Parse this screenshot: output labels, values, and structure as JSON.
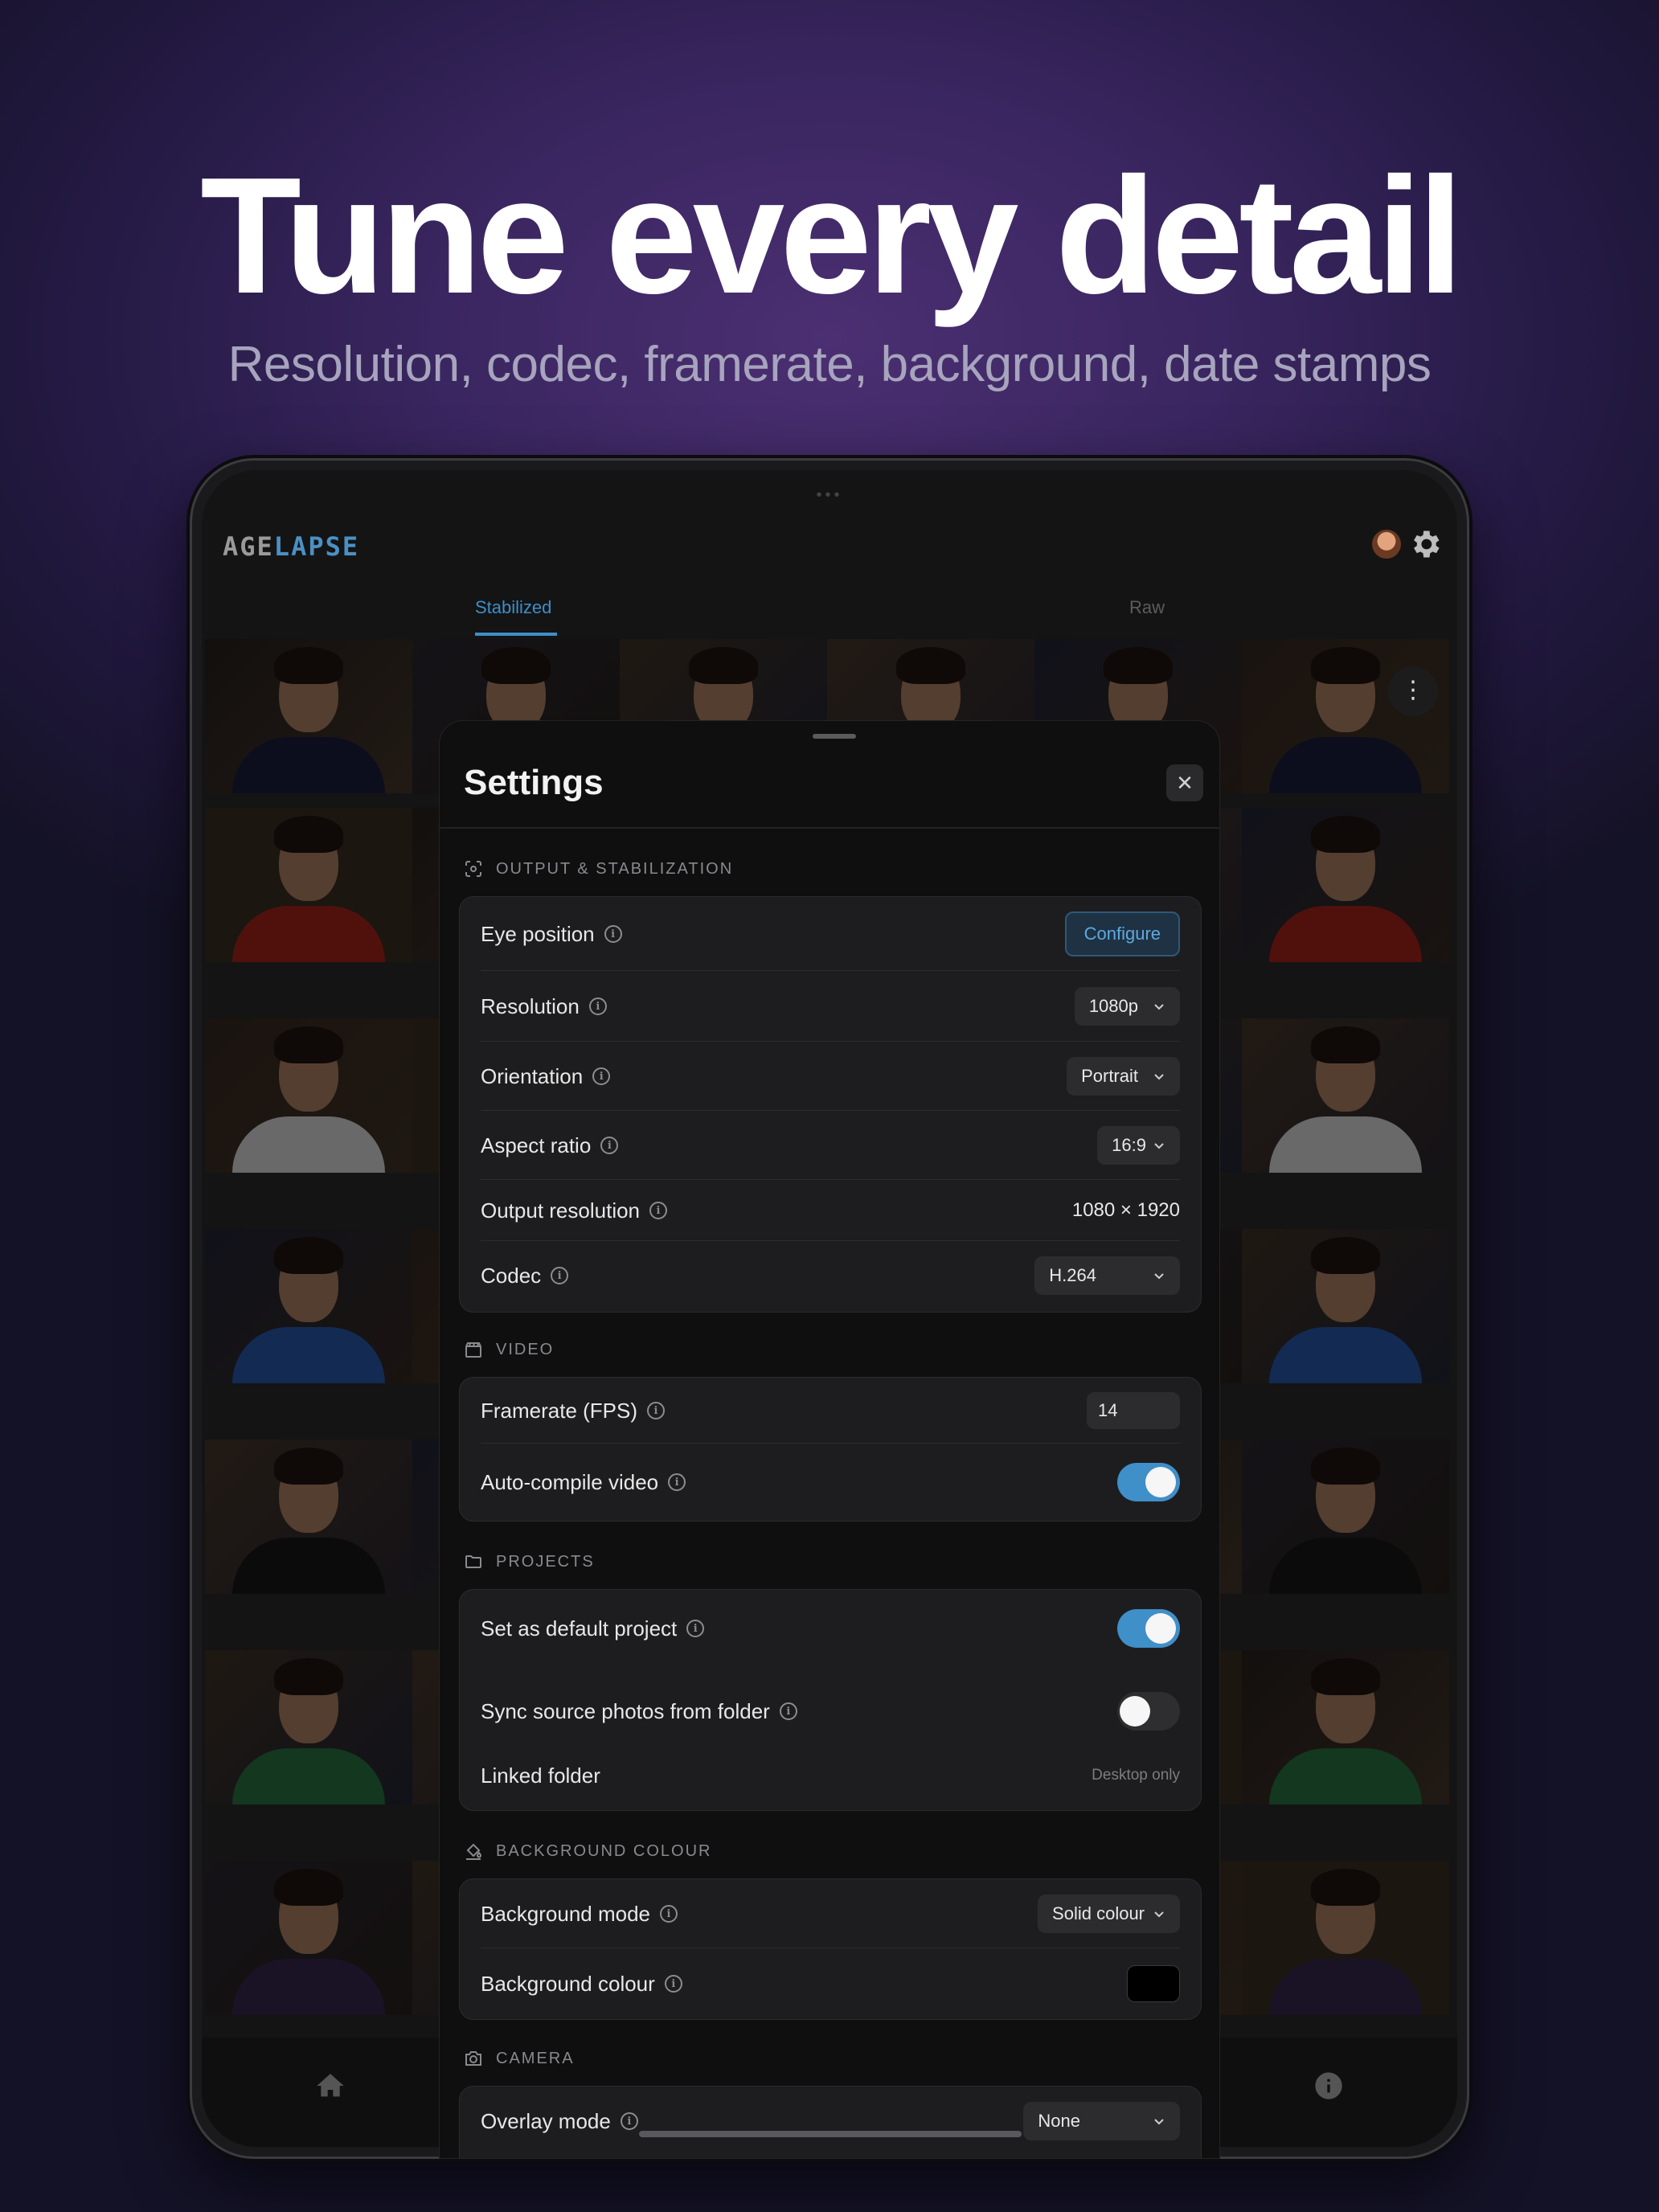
{
  "hero": {
    "headline": "Tune every detail",
    "subheadline": "Resolution, codec, framerate, background, date stamps"
  },
  "app": {
    "logo_part1": "AGE",
    "logo_part2": "LAPSE",
    "tabs": [
      {
        "label": "Stabilized",
        "active": true
      },
      {
        "label": "Raw",
        "active": false
      }
    ]
  },
  "settings": {
    "title": "Settings",
    "close_icon": "close-icon",
    "sections": {
      "output": {
        "label": "OUTPUT & STABILIZATION",
        "eye_position": {
          "label": "Eye position",
          "button": "Configure"
        },
        "resolution": {
          "label": "Resolution",
          "value": "1080p"
        },
        "orientation": {
          "label": "Orientation",
          "value": "Portrait"
        },
        "aspect_ratio": {
          "label": "Aspect ratio",
          "value": "16:9"
        },
        "output_resolution": {
          "label": "Output resolution",
          "value": "1080 × 1920"
        },
        "codec": {
          "label": "Codec",
          "value": "H.264"
        }
      },
      "video": {
        "label": "VIDEO",
        "framerate": {
          "label": "Framerate (FPS)",
          "value": "14"
        },
        "auto_compile": {
          "label": "Auto-compile video",
          "on": true
        }
      },
      "projects": {
        "label": "PROJECTS",
        "default_project": {
          "label": "Set as default project",
          "on": true
        },
        "sync_source": {
          "label": "Sync source photos from folder",
          "on": false
        },
        "linked_folder": {
          "label": "Linked folder",
          "value": "Desktop only"
        }
      },
      "background": {
        "label": "BACKGROUND COLOUR",
        "mode": {
          "label": "Background mode",
          "value": "Solid colour"
        },
        "colour": {
          "label": "Background colour",
          "swatch": "#000000"
        }
      },
      "camera": {
        "label": "CAMERA",
        "overlay_mode": {
          "label": "Overlay mode",
          "value": "None"
        }
      }
    }
  },
  "colors": {
    "accent": "#3f8fc8",
    "background_top": "#4b2f72",
    "sheet": "#0f0f10",
    "card": "#1d1d1f"
  }
}
